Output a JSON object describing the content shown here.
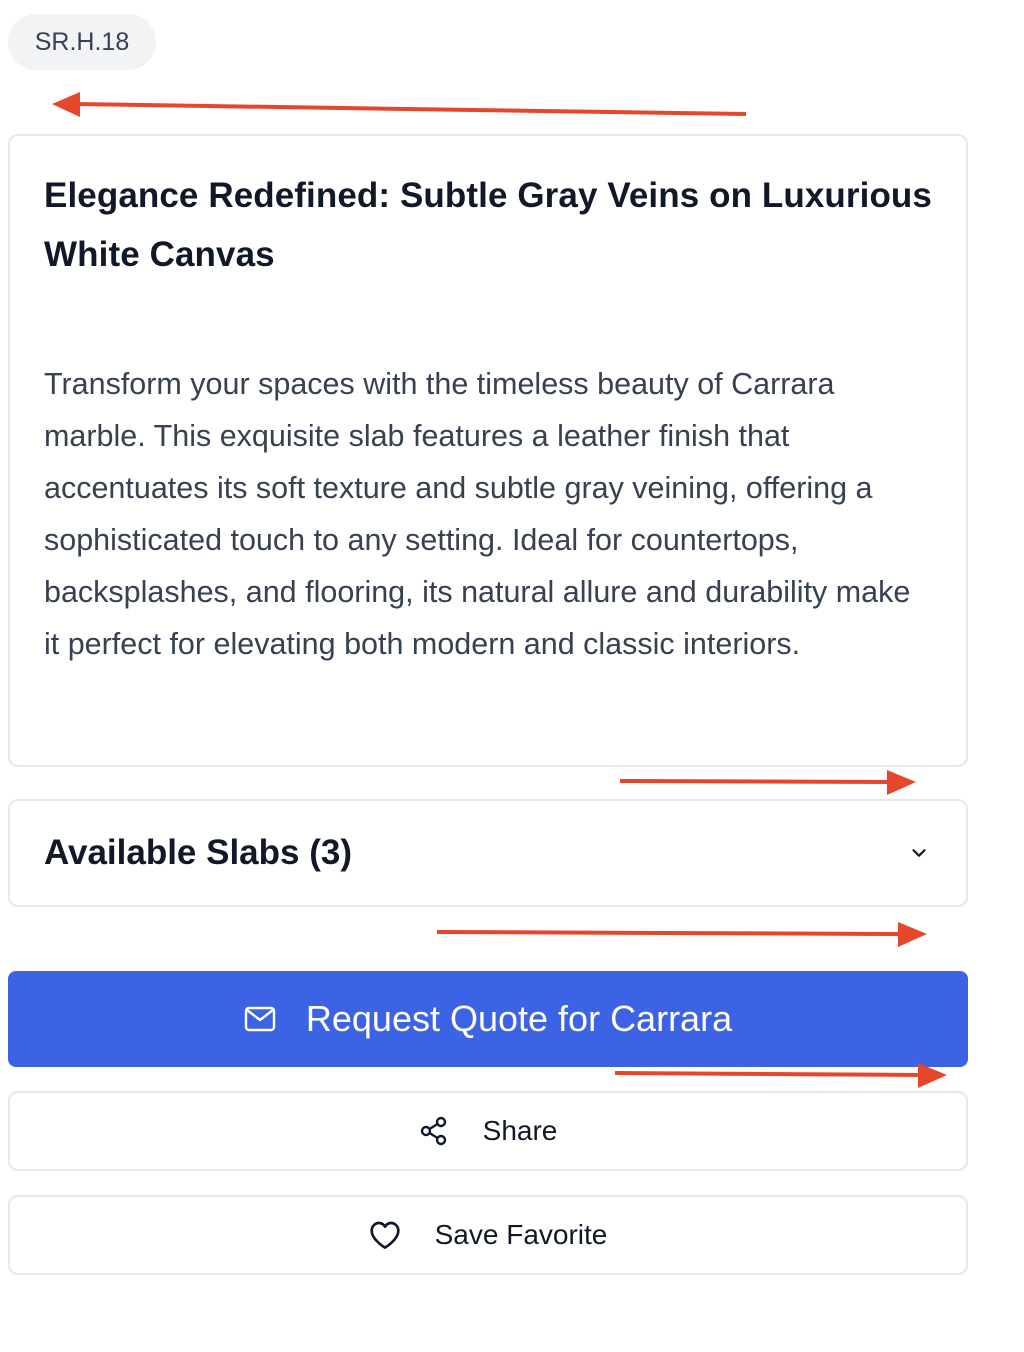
{
  "sku": "SR.H.18",
  "description": {
    "title": "Elegance Redefined: Subtle Gray Veins on Luxurious White Canvas",
    "body": "Transform your spaces with the timeless beauty of Carrara marble. This exquisite slab features a leather finish that accentuates its soft texture and subtle gray veining, offering a sophisticated touch to any setting. Ideal for countertops, backsplashes, and flooring, its natural allure and durability make it perfect for elevating both modern and classic interiors."
  },
  "slabs": {
    "label": "Available Slabs (3)",
    "icon": "chevron-down-icon"
  },
  "actions": {
    "request_quote": {
      "label": "Request Quote for Carrara",
      "icon": "mail-icon"
    },
    "share": {
      "label": "Share",
      "icon": "share-icon"
    },
    "save_favorite": {
      "label": "Save Favorite",
      "icon": "heart-icon"
    }
  },
  "colors": {
    "primary": "#3b63e4",
    "annotation_arrow": "#e5472b",
    "border": "#e5e7eb",
    "badge_bg": "#f1f3f5"
  }
}
